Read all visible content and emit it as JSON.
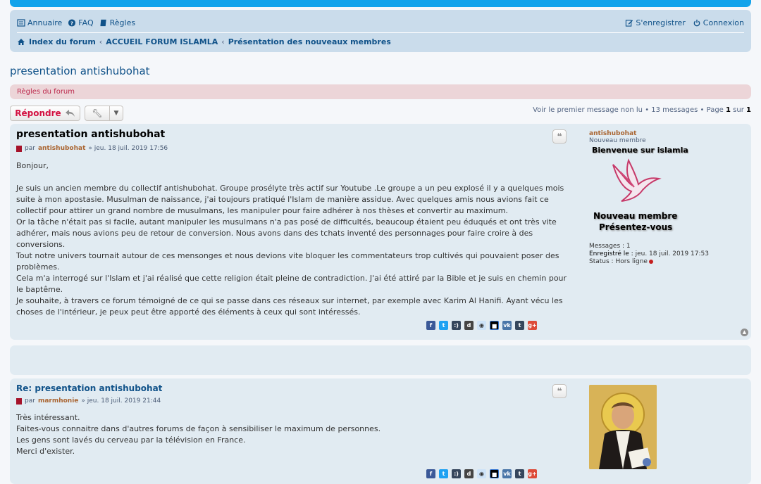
{
  "nav": {
    "annuaire": "Annuaire",
    "faq": "FAQ",
    "regles": "Règles",
    "register": "S'enregistrer",
    "login": "Connexion"
  },
  "breadcrumbs": [
    "Index du forum",
    "ACCUEIL FORUM ISLAMLA",
    "Présentation des nouveaux membres"
  ],
  "topic_title": "presentation antishubohat",
  "forum_rules": "Règles du forum",
  "reply_label": "Répondre",
  "pagination": {
    "first_unread": "Voir le premier message non lu",
    "messages": "13 messages",
    "page_prefix": "Page",
    "page_current": "1",
    "page_sep": "sur",
    "page_total": "1"
  },
  "posts": [
    {
      "title": "presentation antishubohat",
      "by": "par",
      "author": "antishubohat",
      "date": "» jeu. 18 juil. 2019 17:56",
      "paragraphs": [
        "Bonjour,",
        "",
        "Je suis un ancien membre du collectif antishubohat. Groupe prosélyte très actif sur Youtube .Le groupe a un peu explosé il y a quelques mois suite à mon apostasie. Musulman de naissance, j'ai toujours pratiqué l'Islam de manière assidue. Avec quelques amis nous avions fait ce collectif pour attirer un grand nombre de musulmans, les manipuler pour faire adhérer à nos thèses et convertir au maximum.",
        "Or la tâche n'était pas si facile, autant manipuler les musulmans n'a pas posé de difficultés, beaucoup étaient peu éduqués et ont très vite adhérer, mais nous avions peu de retour de conversion. Nous avons dans des tchats inventé des personnages pour faire croire à des conversions.",
        "Tout notre univers tournait autour de ces mensonges et nous devions vite bloquer les commentateurs trop cultivés qui pouvaient poser des problèmes.",
        "Cela m'a interrogé sur l'Islam et j'ai réalisé que cette religion était pleine de contradiction. J'ai été attiré par la Bible et je suis en chemin pour le baptême.",
        "Je souhaite, à travers ce forum témoigné de ce qui se passe dans ces réseaux sur internet, par exemple avec Karim Al Hanifi. Ayant vécu les choses de l'intérieur, je peux peut être apporté des éléments à ceux qui sont intéressés."
      ],
      "profile": {
        "username": "antishubohat",
        "rank": "Nouveau membre",
        "welcome": "Bienvenue sur islamla",
        "rank_image_line1": "Nouveau membre",
        "rank_image_line2": "Présentez-vous",
        "messages_label": "Messages :",
        "messages_value": "1",
        "registered_label": "Enregistré le :",
        "registered_value": "jeu. 18 juil. 2019 17:53",
        "status_label": "Status :",
        "status_value": "Hors ligne"
      }
    },
    {
      "title": "Re: presentation antishubohat",
      "by": "par",
      "author": "marmhonie",
      "date": "» jeu. 18 juil. 2019 21:44",
      "paragraphs": [
        "Très intéressant.",
        "Faites-vous connaitre dans d'autres forums de façon à sensibiliser le maximum de personnes.",
        "Les gens sont lavés du cerveau par la télévision en France.",
        "Merci d'exister."
      ]
    }
  ],
  "share_icons": [
    "facebook-icon",
    "twitter-icon",
    "tumblr-chat-icon",
    "digg-icon",
    "reddit-icon",
    "delicious-icon",
    "vk-icon",
    "tumblr-icon",
    "google-plus-icon"
  ],
  "colors": {
    "accent": "#105289",
    "header_strip": "#12a3eb",
    "post_bg": "#e1ebf2",
    "rules_bg": "#ecd5d8",
    "reply_red": "#d31141",
    "username": "#aa6633"
  }
}
